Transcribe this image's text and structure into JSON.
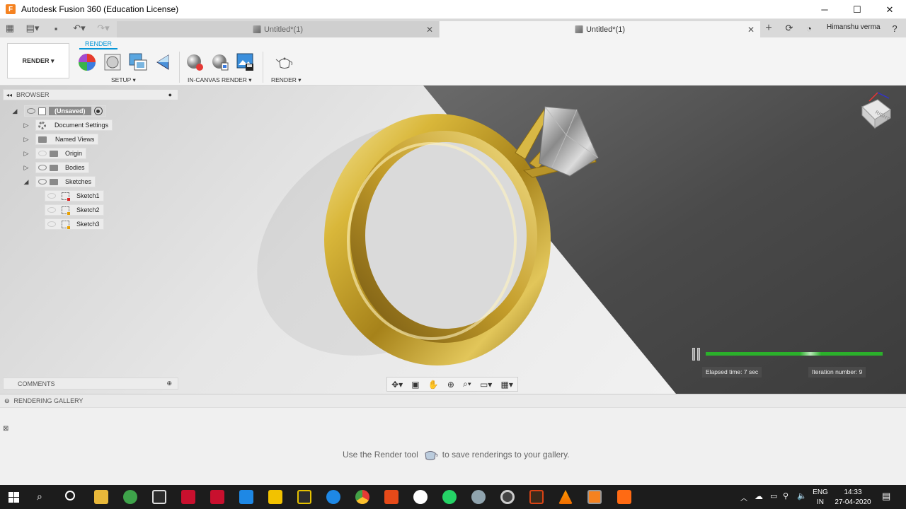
{
  "window": {
    "app_icon_letter": "F",
    "title": "Autodesk Fusion 360 (Education License)",
    "minimize": "─",
    "maximize": "☐",
    "close": "✕"
  },
  "tabs": {
    "inactive_label": "Untitled*(1)",
    "active_label": "Untitled*(1)",
    "close": "✕",
    "add": "+",
    "user": "Himanshu verma"
  },
  "ribbon": {
    "workspace": "RENDER ▾",
    "tab": "RENDER",
    "setup_label": "SETUP ▾",
    "incanvas_label": "IN-CANVAS RENDER ▾",
    "render_label": "RENDER ▾"
  },
  "browser": {
    "title": "BROWSER",
    "root": "(Unsaved)",
    "items": [
      {
        "label": "Document Settings"
      },
      {
        "label": "Named Views"
      },
      {
        "label": "Origin"
      },
      {
        "label": "Bodies"
      },
      {
        "label": "Sketches"
      }
    ],
    "sketches": [
      {
        "label": "Sketch1"
      },
      {
        "label": "Sketch2"
      },
      {
        "label": "Sketch3"
      }
    ]
  },
  "comments": {
    "title": "COMMENTS"
  },
  "viewcube": {
    "face": "RIGHT"
  },
  "render_progress": {
    "elapsed": "Elapsed time: 7 sec",
    "iteration": "Iteration number: 9"
  },
  "gallery": {
    "title": "RENDERING GALLERY",
    "msg_before": "Use the Render tool",
    "msg_after": "to save renderings to your gallery."
  },
  "taskbar": {
    "lang1": "ENG",
    "lang2": "IN",
    "time": "14:33",
    "date": "27-04-2020"
  },
  "colors": {
    "accent": "#0696d7",
    "progress": "#2bb02b",
    "gold": "#c9a52b"
  }
}
